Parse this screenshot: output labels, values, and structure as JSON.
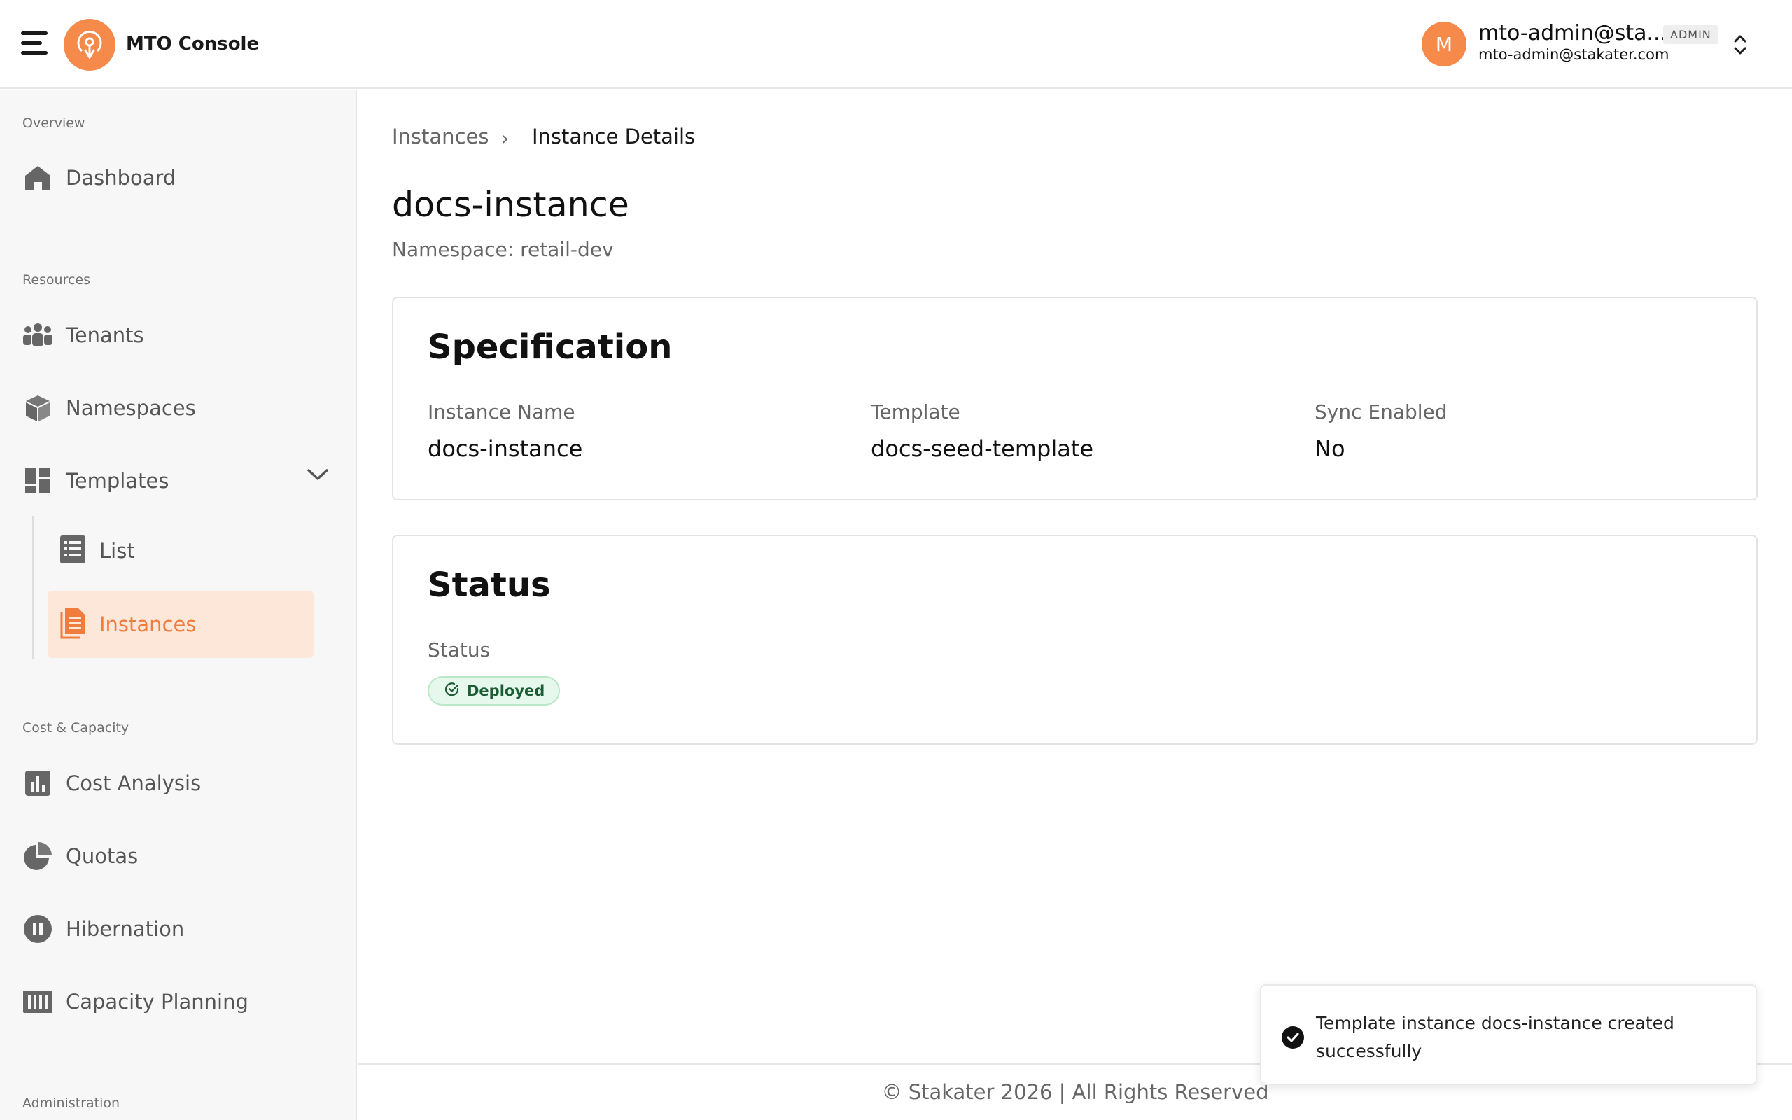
{
  "header": {
    "app_title": "MTO Console",
    "user_initial": "M",
    "user_name": "mto-admin@sta...",
    "user_email": "mto-admin@stakater.com",
    "role_badge": "ADMIN"
  },
  "sidebar": {
    "sections": {
      "overview": "Overview",
      "resources": "Resources",
      "cost_capacity": "Cost & Capacity",
      "administration": "Administration"
    },
    "items": {
      "dashboard": "Dashboard",
      "tenants": "Tenants",
      "namespaces": "Namespaces",
      "templates": "Templates",
      "list": "List",
      "instances": "Instances",
      "cost_analysis": "Cost Analysis",
      "quotas": "Quotas",
      "hibernation": "Hibernation",
      "capacity_planning": "Capacity Planning"
    }
  },
  "breadcrumb": {
    "parent": "Instances",
    "separator": "›",
    "current": "Instance Details"
  },
  "page": {
    "title": "docs-instance",
    "subtitle": "Namespace: retail-dev"
  },
  "specification": {
    "title": "Specification",
    "fields": [
      {
        "label": "Instance Name",
        "value": "docs-instance"
      },
      {
        "label": "Template",
        "value": "docs-seed-template"
      },
      {
        "label": "Sync Enabled",
        "value": "No"
      }
    ]
  },
  "status": {
    "title": "Status",
    "label": "Status",
    "badge": "Deployed"
  },
  "footer": {
    "text": "© Stakater 2026 | All Rights Reserved"
  },
  "toast": {
    "message": "Template instance docs-instance created successfully"
  },
  "colors": {
    "accent": "#f58a4b",
    "active_bg": "#fde7d9",
    "success_bg": "#e6f8ec",
    "success_text": "#1d5c35"
  }
}
